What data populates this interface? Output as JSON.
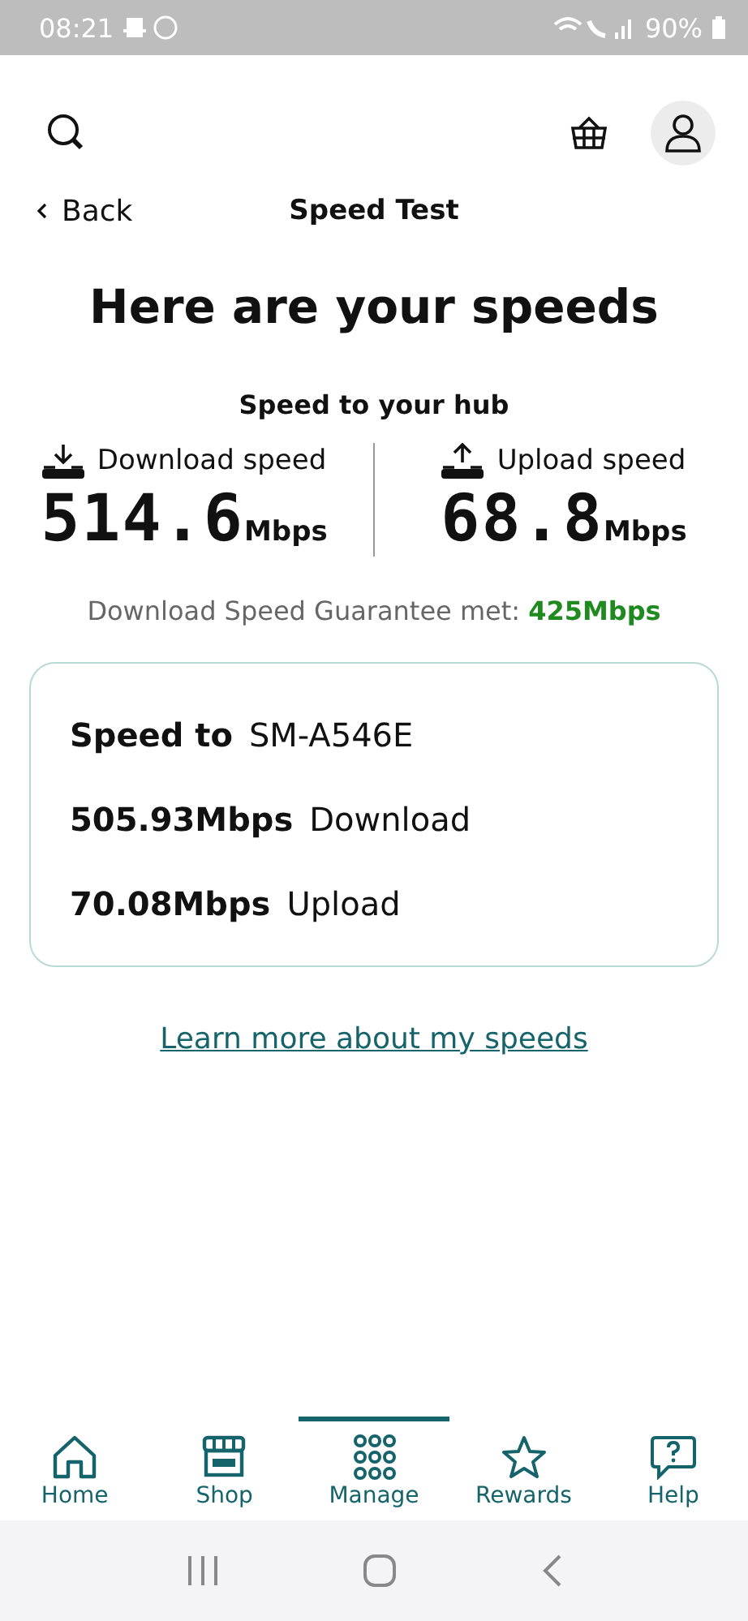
{
  "status_bar": {
    "time": "08:21",
    "battery": "90%"
  },
  "header": {
    "back": "Back",
    "title": "Speed Test"
  },
  "headline": "Here are your speeds",
  "hub": {
    "title": "Speed to your hub",
    "metrics": [
      {
        "kind": "download",
        "label": "Download speed",
        "value": "514.6",
        "unit": "Mbps"
      },
      {
        "kind": "upload",
        "label": "Upload speed",
        "value": "68.8",
        "unit": "Mbps"
      }
    ]
  },
  "guarantee": {
    "text": "Download Speed Guarantee met:",
    "value": "425Mbps"
  },
  "device_card": {
    "label": "Speed to",
    "device": "SM-A546E",
    "rows": [
      {
        "value": "505.93Mbps",
        "label": "Download"
      },
      {
        "value": "70.08Mbps",
        "label": "Upload"
      }
    ]
  },
  "link": "Learn more about my speeds",
  "nav": [
    {
      "kind": "home",
      "label": "Home",
      "selected": false
    },
    {
      "kind": "shop",
      "label": "Shop",
      "selected": false
    },
    {
      "kind": "manage",
      "label": "Manage",
      "selected": true
    },
    {
      "kind": "rewards",
      "label": "Rewards",
      "selected": false
    },
    {
      "kind": "help",
      "label": "Help",
      "selected": false
    }
  ]
}
